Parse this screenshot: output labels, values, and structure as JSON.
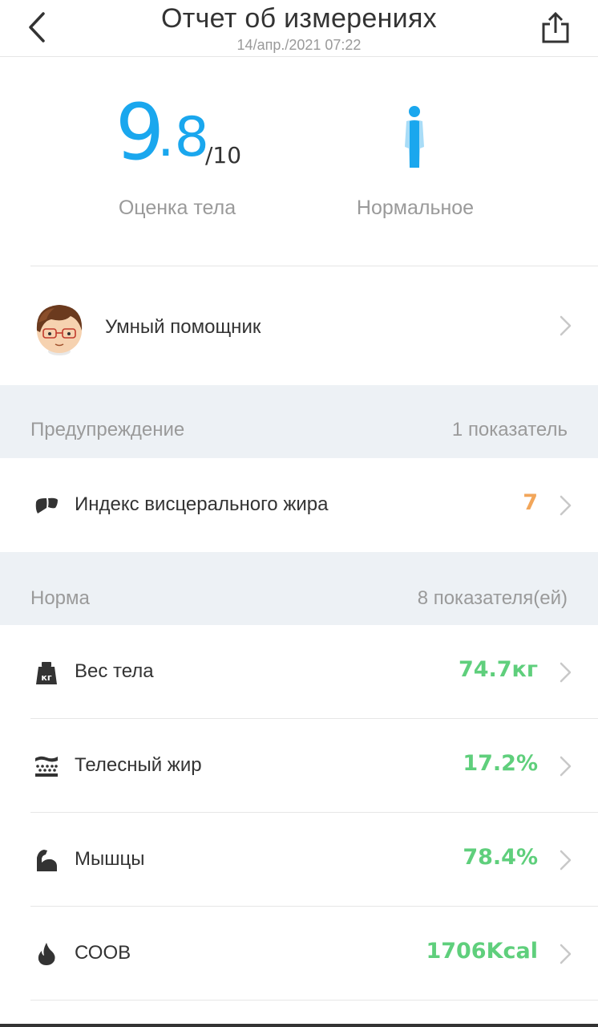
{
  "header": {
    "title": "Отчет об измерениях",
    "date": "14/апр./2021 07:22"
  },
  "score": {
    "integer": "9",
    "decimal": ".8",
    "max": "/10",
    "label": "Оценка тела",
    "value": 9.8,
    "body_type_label": "Нормальное",
    "accent_color": "#1aa7ee"
  },
  "assistant": {
    "label": "Умный помощник"
  },
  "warning_section": {
    "title": "Предупреждение",
    "count": "1 показатель",
    "items": [
      {
        "label": "Индекс висцерального жира",
        "value": "7",
        "icon": "visceral-fat-icon",
        "color": "#f2a65a"
      }
    ]
  },
  "normal_section": {
    "title": "Норма",
    "count": "8 показателя(ей)",
    "items": [
      {
        "label": "Вес тела",
        "value": "74.7кг",
        "icon": "weight-icon",
        "color": "#5fcf7c"
      },
      {
        "label": "Телесный жир",
        "value": "17.2%",
        "icon": "body-fat-icon",
        "color": "#5fcf7c"
      },
      {
        "label": "Мышцы",
        "value": "78.4%",
        "icon": "muscle-icon",
        "color": "#5fcf7c"
      },
      {
        "label": "СООВ",
        "value": "1706Kcal",
        "icon": "flame-icon",
        "color": "#5fcf7c"
      }
    ]
  },
  "icons": {
    "back": "chevron-left-icon",
    "share": "share-icon",
    "body": "body-figure-icon",
    "chevron": "chevron-right-icon"
  }
}
